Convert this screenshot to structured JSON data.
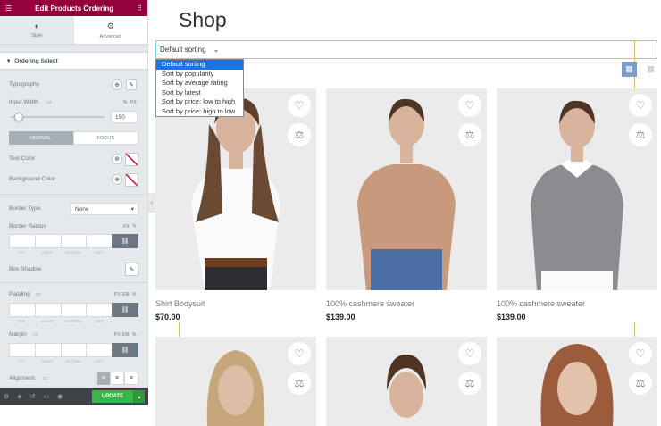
{
  "panel": {
    "title": "Edit Products Ordering",
    "tabs": [
      {
        "label": "Style",
        "icon": "contrast-icon"
      },
      {
        "label": "Advanced",
        "icon": "gear-icon"
      }
    ],
    "section_title": "Ordering Select",
    "controls": {
      "typography": "Typography",
      "input_width": "Input Width",
      "input_width_unit": "%",
      "input_width_unit2": "PX",
      "input_width_value": "150",
      "slider_level_fraction": 0.08,
      "state_normal": "NORMAL",
      "state_focus": "FOCUS",
      "text_color": "Text Color",
      "background_color": "Background Color",
      "border_type": "Border Type",
      "border_type_value": "None",
      "border_radius": "Border Radius",
      "border_radius_unit": "PX",
      "box_shadow": "Box Shadow",
      "padding": "Padding",
      "padding_units": [
        "PX",
        "EM",
        "%"
      ],
      "margin": "Margin",
      "margin_units": [
        "PX",
        "EM",
        "%"
      ],
      "alignment": "Alignment",
      "dim_labels": [
        "TOP",
        "RIGHT",
        "BOTTOM",
        "LEFT"
      ]
    },
    "footer": {
      "update": "UPDATE"
    }
  },
  "main": {
    "title": "Shop",
    "sort_value": "Default sorting",
    "sort_options": [
      "Default sorting",
      "Sort by popularity",
      "Sort by average rating",
      "Sort by latest",
      "Sort by price: low to high",
      "Sort by price: high to low"
    ],
    "products": [
      {
        "name": "Shirt Bodysuit",
        "price": "$70.00"
      },
      {
        "name": "100% cashmere sweater",
        "price": "$139.00"
      },
      {
        "name": "100% cashmere sweater",
        "price": "$139.00"
      }
    ]
  },
  "colors": {
    "header": "#93003c",
    "accent": "#1e72e8",
    "update": "#39b54a"
  }
}
